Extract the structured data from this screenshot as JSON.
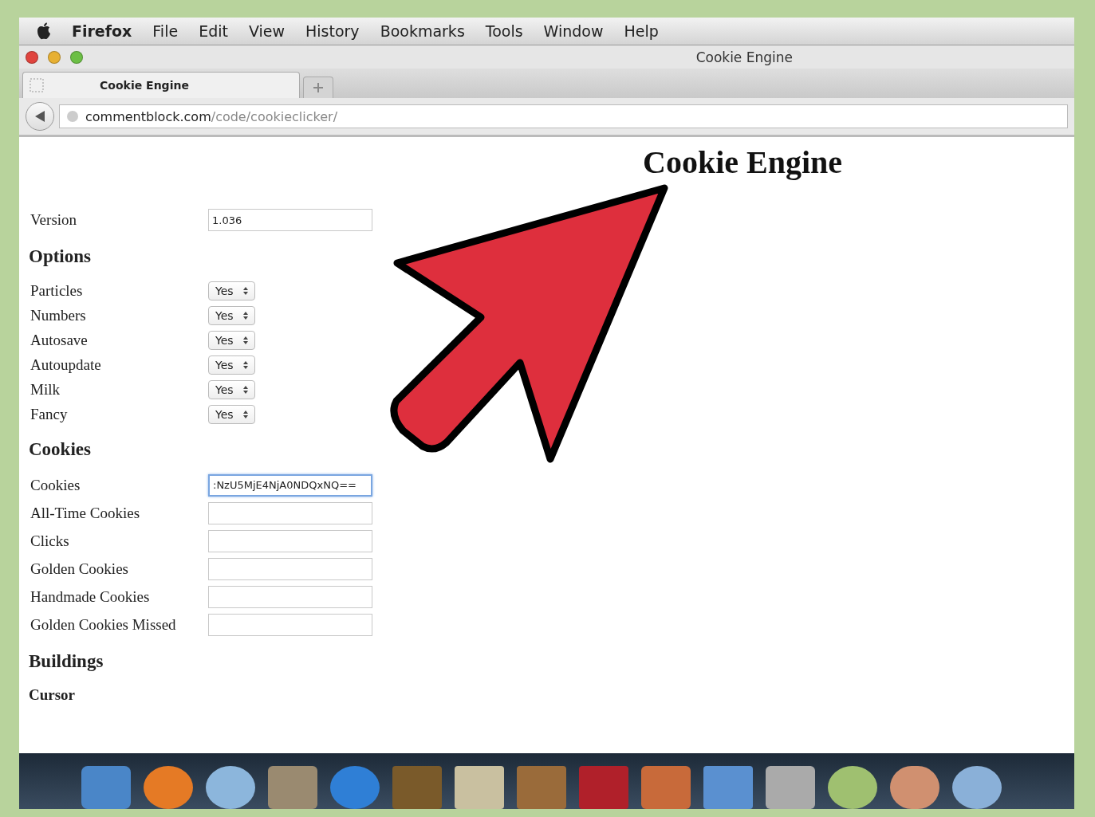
{
  "menu_bar": {
    "app_name": "Firefox",
    "menus": [
      "File",
      "Edit",
      "View",
      "History",
      "Bookmarks",
      "Tools",
      "Window",
      "Help"
    ]
  },
  "window": {
    "title": "Cookie Engine"
  },
  "tabs": [
    {
      "label": "Cookie Engine",
      "selected": true
    }
  ],
  "address_bar": {
    "domain": "commentblock.com",
    "path": "/code/cookieclicker/"
  },
  "page": {
    "heading": "Cookie Engine",
    "version": {
      "label": "Version",
      "value": "1.036"
    },
    "options": {
      "title": "Options",
      "rows": [
        {
          "label": "Particles",
          "value": "Yes"
        },
        {
          "label": "Numbers",
          "value": "Yes"
        },
        {
          "label": "Autosave",
          "value": "Yes"
        },
        {
          "label": "Autoupdate",
          "value": "Yes"
        },
        {
          "label": "Milk",
          "value": "Yes"
        },
        {
          "label": "Fancy",
          "value": "Yes"
        }
      ]
    },
    "cookies": {
      "title": "Cookies",
      "fields": [
        {
          "label": "Cookies",
          "value": ":NzU5MjE4NjA0NDQxNQ==",
          "focused": true
        },
        {
          "label": "All-Time Cookies",
          "focused": false
        },
        {
          "label": "Clicks",
          "focused": false
        },
        {
          "label": "Golden Cookies",
          "focused": false
        },
        {
          "label": "Handmade Cookies",
          "focused": false
        },
        {
          "label": "Golden Cookies Missed",
          "focused": false
        }
      ]
    },
    "buildings": {
      "title": "Buildings",
      "subheading": "Cursor"
    }
  }
}
